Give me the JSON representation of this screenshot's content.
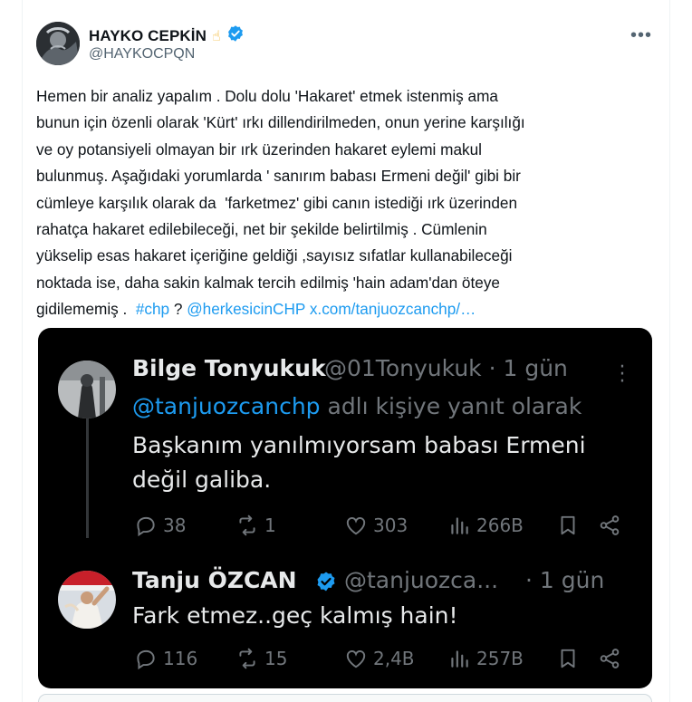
{
  "author": {
    "display_name": "HAYKO CEPKİN",
    "emoji": "☝",
    "handle": "@HAYKOCPQN",
    "verified": true
  },
  "more_label": "•••",
  "tweet": {
    "text_1": "Hemen bir analiz yapalım . Dolu dolu 'Hakaret' etmek istenmiş ama\nbunun için özenli olarak 'Kürt' ırkı dillendirilmeden, onun yerine karşılığı\nve oy potansiyeli olmayan bir ırk üzerinden hakaret eylemi makul\nbulunmuş. Aşağıdaki yorumlarda ' sanırım babası Ermeni değil' gibi bir\ncümleye karşılık olarak da  'farketmez' gibi canın istediği ırk üzerinden\nrahatça hakaret edilebileceği, net bir şekilde belirtilmiş . Cümlenin\nyükselip esas hakaret içeriğine geldiği ,sayısız sıfatlar kullanabileceği\nnoktada ise, daha sakin kalmak tercih edilmiş 'hain adam'dan öteye\ngidilememiş .  ",
    "hashtag": "#chp",
    "sep": " ? ",
    "mention": "@herkesicinCHP",
    "space": " ",
    "url": "x.com/tanjuozcanchp/…"
  },
  "media": {
    "reply1": {
      "name": "Bilge Tonyukuk",
      "handle_time": "@01Tonyukuk · 1 gün",
      "reply_to_handle": "@tanjuozcanchp",
      "reply_to_suffix": " adlı kişiye yanıt olarak",
      "body_line1": "Başkanım yanılmıyorsam babası Ermeni",
      "body_line2": "değil galiba.",
      "comments": "38",
      "retweets": "1",
      "likes": "303",
      "views": "266B"
    },
    "reply2": {
      "name": "Tanju ÖZCAN",
      "handle": "@tanjuozca...",
      "time": "· 1 gün",
      "body": "Fark etmez..geç kalmış hain!",
      "comments": "116",
      "retweets": "15",
      "likes": "2,4B",
      "views": "257B"
    }
  },
  "colors": {
    "accent": "#1d9bf0",
    "text": "#0f1419",
    "muted": "#536471",
    "media_bg": "#000000",
    "media_text": "#e7e9ea",
    "media_muted": "#71767b"
  }
}
